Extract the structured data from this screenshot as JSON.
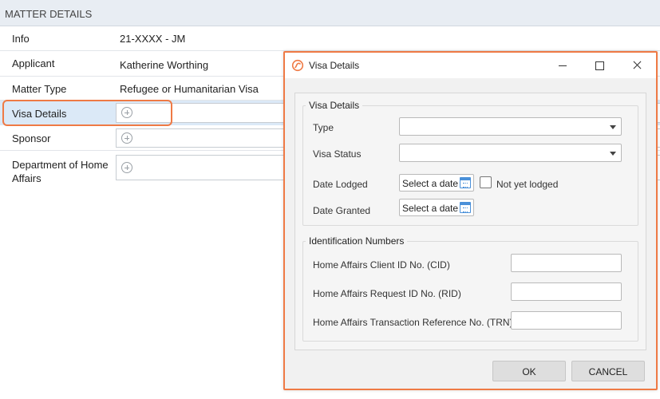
{
  "matter": {
    "header": "MATTER DETAILS",
    "rows": [
      {
        "label": "Info",
        "value": "21-XXXX - JM"
      },
      {
        "label": "Applicant",
        "value": "Katherine Worthing"
      },
      {
        "label": "Matter Type",
        "value": "Refugee or Humanitarian Visa"
      },
      {
        "label": "Visa Details",
        "value": ""
      },
      {
        "label": "Sponsor",
        "value": ""
      },
      {
        "label": "Department of Home Affairs",
        "value": ""
      }
    ]
  },
  "dialog": {
    "title": "Visa Details",
    "visa_group": {
      "legend": "Visa Details",
      "type_label": "Type",
      "type_value": "",
      "status_label": "Visa Status",
      "status_value": "",
      "lodged_label": "Date Lodged",
      "lodged_placeholder": "Select a date",
      "not_lodged_label": "Not yet lodged",
      "not_lodged_checked": false,
      "granted_label": "Date Granted",
      "granted_placeholder": "Select a date"
    },
    "id_group": {
      "legend": "Identification Numbers",
      "cid_label": "Home Affairs Client ID No. (CID)",
      "cid_value": "",
      "rid_label": "Home Affairs Request ID No. (RID)",
      "rid_value": "",
      "trn_label": "Home Affairs Transaction Reference No. (TRN)",
      "trn_value": ""
    },
    "ok_label": "OK",
    "cancel_label": "CANCEL"
  },
  "colors": {
    "highlight": "#ef7a45",
    "selected_row": "#dbe9f7",
    "calendar_icon": "#4a90d9"
  }
}
